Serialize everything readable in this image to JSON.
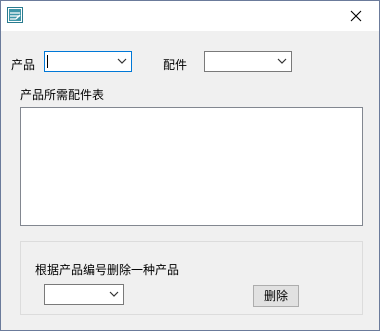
{
  "window": {
    "title": ""
  },
  "form": {
    "product_label": "产品",
    "product_value": "",
    "part_label": "配件",
    "part_value": "",
    "parts_table_label": "产品所需配件表",
    "delete_group_label": "根据产品编号删除一种产品",
    "delete_code_value": "",
    "delete_button_label": "删除"
  },
  "icons": {
    "app": "app-icon",
    "close": "close-icon",
    "dropdown": "chevron-down-icon"
  },
  "colors": {
    "focus_border": "#0078d7",
    "titlebar": "#ffffff",
    "client": "#f0f0f0"
  }
}
